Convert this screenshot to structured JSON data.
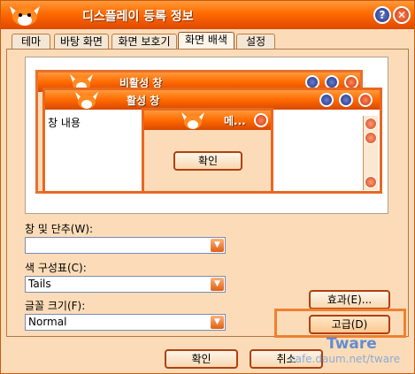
{
  "window": {
    "title": "디스플레이 등록 정보",
    "help_label": "?",
    "close_label": "✕"
  },
  "tabs": [
    {
      "label": "테마",
      "active": false
    },
    {
      "label": "바탕 화면",
      "active": false
    },
    {
      "label": "화면 보호기",
      "active": false
    },
    {
      "label": "화면 배색",
      "active": true
    },
    {
      "label": "설정",
      "active": false
    }
  ],
  "preview": {
    "inactive_title": "비활성 창",
    "active_title": "활성 창",
    "window_text": "창 내용",
    "msgbox_title": "메...",
    "msgbox_ok": "확인"
  },
  "form": {
    "window_buttons_label": "창 및 단추(W):",
    "window_buttons_value": "",
    "color_scheme_label": "색 구성표(C):",
    "color_scheme_value": "Tails",
    "font_size_label": "글꼴 크기(F):",
    "font_size_value": "Normal"
  },
  "buttons": {
    "effects": "효과(E)...",
    "advanced": "고급(D)",
    "ok": "확인",
    "cancel": "취소"
  },
  "watermark": {
    "brand": "Tware",
    "url": "cafe.daum.net/tware"
  },
  "colors": {
    "accent": "#ff6a00",
    "title_blue": "#1c2e88",
    "highlight": "#f08030"
  }
}
